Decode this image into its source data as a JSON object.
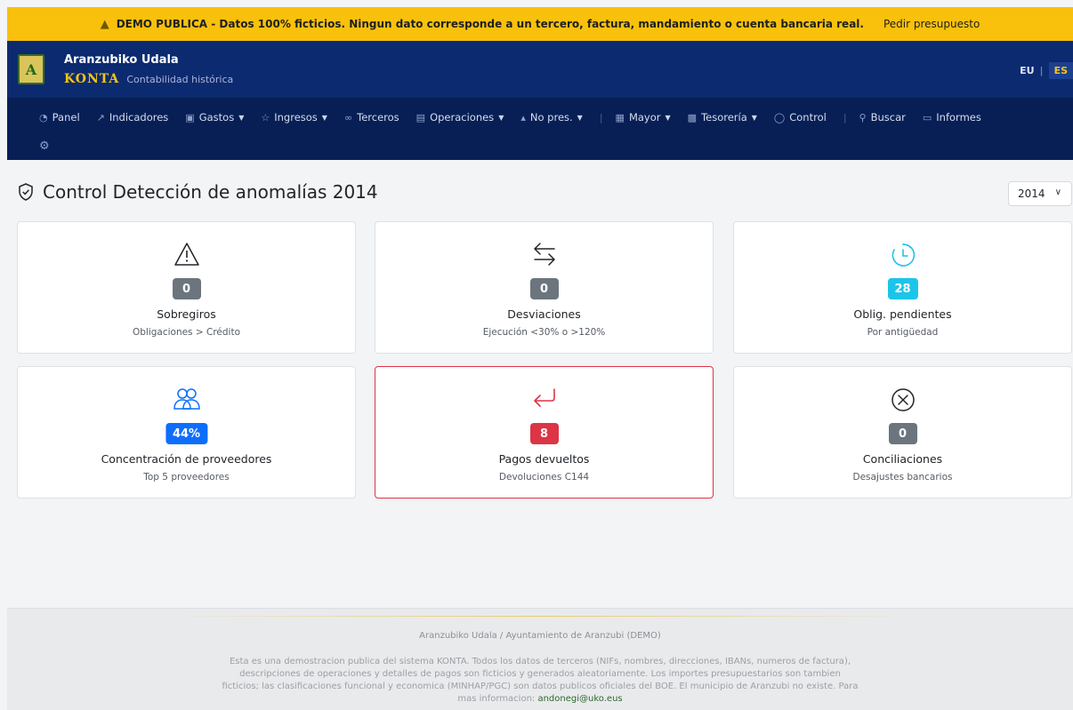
{
  "banner": {
    "text": "DEMO PUBLICA - Datos 100% ficticios. Ningun dato corresponde a un tercero, factura, mandamiento o cuenta bancaria real.",
    "link": "Pedir presupuesto"
  },
  "header": {
    "logo_letter": "A",
    "town": "Aranzubiko Udala",
    "brand": "KONTA",
    "subtitle": "Contabilidad histórica",
    "lang_eu": "EU",
    "lang_sep": "|",
    "lang_es": "ES"
  },
  "nav": {
    "panel": "Panel",
    "indicadores": "Indicadores",
    "gastos": "Gastos",
    "ingresos": "Ingresos",
    "terceros": "Terceros",
    "operaciones": "Operaciones",
    "no_pres": "No pres.",
    "mayor": "Mayor",
    "tesoreria": "Tesorería",
    "control": "Control",
    "buscar": "Buscar",
    "informes": "Informes",
    "separator": "|"
  },
  "page": {
    "title": "Control Detección de anomalías 2014",
    "year": "2014"
  },
  "cards": [
    {
      "value": "0",
      "title": "Sobregiros",
      "subtitle": "Obligaciones > Crédito",
      "icon": "warning-icon",
      "badge_color": "#6c757d"
    },
    {
      "value": "0",
      "title": "Desviaciones",
      "subtitle": "Ejecución <30% o >120%",
      "icon": "arrows-exchange-icon",
      "badge_color": "#6c757d"
    },
    {
      "value": "28",
      "title": "Oblig. pendientes",
      "subtitle": "Por antigüedad",
      "icon": "clock-icon",
      "badge_color": "#1cc4ea"
    },
    {
      "value": "44%",
      "title": "Concentración de proveedores",
      "subtitle": "Top 5 proveedores",
      "icon": "people-icon",
      "badge_color": "#0d6efd"
    },
    {
      "value": "8",
      "title": "Pagos devueltos",
      "subtitle": "Devoluciones C144",
      "icon": "return-arrow-icon",
      "badge_color": "#dc3545"
    },
    {
      "value": "0",
      "title": "Conciliaciones",
      "subtitle": "Desajustes bancarios",
      "icon": "x-circle-icon",
      "badge_color": "#6c757d"
    }
  ],
  "footer": {
    "org": "Aranzubiko Udala / Ayuntamiento de Aranzubi (DEMO)",
    "disclaimer": "Esta es una demostracion publica del sistema KONTA. Todos los datos de terceros (NIFs, nombres, direcciones, IBANs, numeros de factura), descripciones de operaciones y detalles de pagos son ficticios y generados aleatoriamente. Los importes presupuestarios son tambien ficticios; las clasificaciones funcional y economica (MINHAP/PGC) son datos publicos oficiales del BOE. El municipio de Aranzubi no existe. Para mas informacion:",
    "email": "andonegi@uko.eus"
  }
}
